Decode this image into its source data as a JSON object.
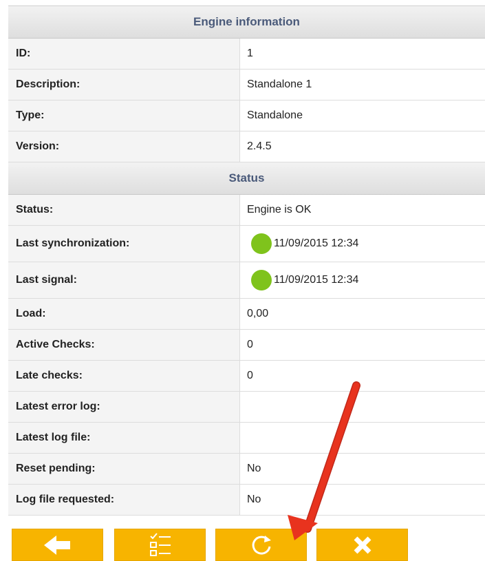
{
  "engine_info": {
    "header": "Engine information",
    "rows": [
      {
        "label": "ID:",
        "value": "1"
      },
      {
        "label": "Description:",
        "value": "Standalone 1"
      },
      {
        "label": "Type:",
        "value": "Standalone"
      },
      {
        "label": "Version:",
        "value": "2.4.5"
      }
    ]
  },
  "status": {
    "header": "Status",
    "status_label": "Status:",
    "status_value": "Engine is OK",
    "last_sync_label": "Last synchronization:",
    "last_sync_value": "11/09/2015 12:34",
    "last_signal_label": "Last signal:",
    "last_signal_value": "11/09/2015 12:34",
    "load_label": "Load:",
    "load_value": "0,00",
    "active_checks_label": "Active Checks:",
    "active_checks_value": "0",
    "late_checks_label": "Late checks:",
    "late_checks_value": "0",
    "latest_error_log_label": "Latest error log:",
    "latest_error_log_value": "",
    "latest_log_file_label": "Latest log file:",
    "latest_log_file_value": "",
    "reset_pending_label": "Reset pending:",
    "reset_pending_value": "No",
    "log_file_requested_label": "Log file requested:",
    "log_file_requested_value": "No"
  },
  "indicator_color": "#7fc31c",
  "toolbar": {
    "button_color": "#f7b400",
    "buttons": [
      {
        "icon": "arrow-left-icon"
      },
      {
        "icon": "checklist-icon"
      },
      {
        "icon": "refresh-icon"
      },
      {
        "icon": "close-icon"
      }
    ]
  },
  "annotation_color": "#e8331e"
}
